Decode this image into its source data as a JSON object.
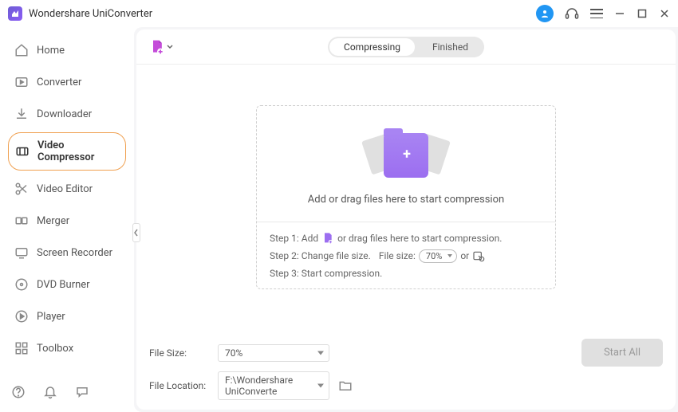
{
  "app": {
    "title": "Wondershare UniConverter"
  },
  "sidebar": {
    "items": [
      {
        "label": "Home"
      },
      {
        "label": "Converter"
      },
      {
        "label": "Downloader"
      },
      {
        "label": "Video Compressor"
      },
      {
        "label": "Video Editor"
      },
      {
        "label": "Merger"
      },
      {
        "label": "Screen Recorder"
      },
      {
        "label": "DVD Burner"
      },
      {
        "label": "Player"
      },
      {
        "label": "Toolbox"
      }
    ]
  },
  "tabs": {
    "compressing": "Compressing",
    "finished": "Finished"
  },
  "drop": {
    "heading": "Add or drag files here to start compression",
    "step1_prefix": "Step 1: Add",
    "step1_suffix": "or drag files here to start compression.",
    "step2_prefix": "Step 2: Change file size.",
    "step2_label": "File size:",
    "step2_value": "70%",
    "step2_or": "or",
    "step3": "Step 3: Start compression."
  },
  "footer": {
    "file_size_label": "File Size:",
    "file_size_value": "70%",
    "file_location_label": "File Location:",
    "file_location_value": "F:\\Wondershare UniConverte",
    "start_label": "Start All"
  }
}
